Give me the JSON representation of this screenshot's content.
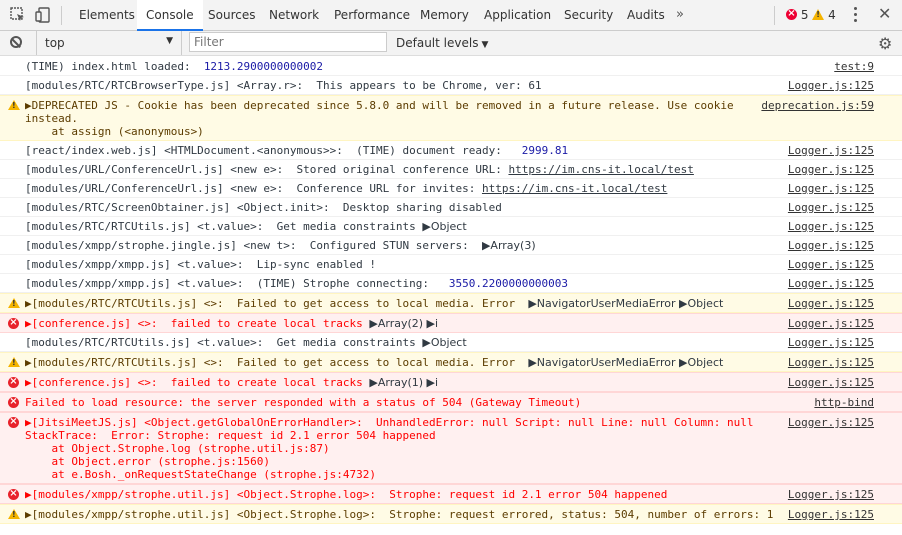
{
  "tabs": [
    {
      "label": "Elements"
    },
    {
      "label": "Console"
    },
    {
      "label": "Sources"
    },
    {
      "label": "Network"
    },
    {
      "label": "Performance"
    },
    {
      "label": "Memory"
    },
    {
      "label": "Application"
    },
    {
      "label": "Security"
    },
    {
      "label": "Audits"
    }
  ],
  "more_tabs": "»",
  "counts": {
    "errors": "5",
    "warnings": "4"
  },
  "toolbar": {
    "context": "top",
    "filter_placeholder": "Filter",
    "levels": "Default levels"
  },
  "colors": {
    "accent": "#1a73e8",
    "error_bg": "#fff0f0",
    "warn_bg": "#fffbe5",
    "error_text": "#ff0000"
  },
  "log": [
    {
      "level": "info",
      "text": "(TIME) index.html loaded:  ",
      "num": "1213.2900000000002",
      "source": "test:9"
    },
    {
      "level": "info",
      "text": "[modules/RTC/RTCBrowserType.js] <Array.r>:  This appears to be Chrome, ver: 61",
      "source": "Logger.js:125"
    },
    {
      "level": "warn",
      "text": "▶DEPRECATED JS - Cookie has been deprecated since 5.8.0 and will be removed in a future release. Use cookie\ninstead.\n    at assign (<anonymous>)",
      "source": "deprecation.js:59"
    },
    {
      "level": "info",
      "text": "[react/index.web.js] <HTMLDocument.<anonymous>>:  (TIME) document ready:   ",
      "num": "2999.81",
      "source": "Logger.js:125"
    },
    {
      "level": "info",
      "text": "[modules/URL/ConferenceUrl.js] <new e>:  Stored original conference URL: ",
      "link": "https://im.cns-it.local/test",
      "source": "Logger.js:125"
    },
    {
      "level": "info",
      "text": "[modules/URL/ConferenceUrl.js] <new e>:  Conference URL for invites: ",
      "link": "https://im.cns-it.local/test",
      "source": "Logger.js:125"
    },
    {
      "level": "info",
      "text": "[modules/RTC/ScreenObtainer.js] <Object.init>:  Desktop sharing disabled",
      "source": "Logger.js:125"
    },
    {
      "level": "info",
      "text": "[modules/RTC/RTCUtils.js] <t.value>:  Get media constraints ",
      "obj": "▶Object",
      "source": "Logger.js:125"
    },
    {
      "level": "info",
      "text": "[modules/xmpp/strophe.jingle.js] <new t>:  Configured STUN servers:  ",
      "obj": "▶Array(3)",
      "source": "Logger.js:125"
    },
    {
      "level": "info",
      "text": "[modules/xmpp/xmpp.js] <t.value>:  Lip-sync enabled !",
      "source": "Logger.js:125"
    },
    {
      "level": "info",
      "text": "[modules/xmpp/xmpp.js] <t.value>:  (TIME) Strophe connecting:   ",
      "num": "3550.2200000000003",
      "source": "Logger.js:125"
    },
    {
      "level": "warn",
      "text": "▶[modules/RTC/RTCUtils.js] <>:  Failed to get access to local media. Error  ",
      "obj": "▶NavigatorUserMediaError ▶Object",
      "source": "Logger.js:125"
    },
    {
      "level": "error",
      "text": "▶[conference.js] <>:  failed to create local tracks ",
      "obj": "▶Array(2) ▶i",
      "source": "Logger.js:125"
    },
    {
      "level": "info",
      "text": "[modules/RTC/RTCUtils.js] <t.value>:  Get media constraints ",
      "obj": "▶Object",
      "source": "Logger.js:125"
    },
    {
      "level": "warn",
      "text": "▶[modules/RTC/RTCUtils.js] <>:  Failed to get access to local media. Error  ",
      "obj": "▶NavigatorUserMediaError ▶Object",
      "source": "Logger.js:125"
    },
    {
      "level": "error",
      "text": "▶[conference.js] <>:  failed to create local tracks ",
      "obj": "▶Array(1) ▶i",
      "source": "Logger.js:125"
    },
    {
      "level": "error",
      "text": "Failed to load resource: the server responded with a status of 504 (Gateway Timeout)",
      "source": "http-bind"
    },
    {
      "level": "error",
      "text": "▶[JitsiMeetJS.js] <Object.getGlobalOnErrorHandler>:  UnhandledError: null Script: null Line: null Column: null\nStackTrace:  Error: Strophe: request id 2.1 error 504 happened\n    at Object.Strophe.log (strophe.util.js:87)\n    at Object.error (strophe.js:1560)\n    at e.Bosh._onRequestStateChange (strophe.js:4732)",
      "source": "Logger.js:125"
    },
    {
      "level": "error",
      "text": "▶[modules/xmpp/strophe.util.js] <Object.Strophe.log>:  Strophe: request id 2.1 error 504 happened",
      "source": "Logger.js:125"
    },
    {
      "level": "warn",
      "text": "▶[modules/xmpp/strophe.util.js] <Object.Strophe.log>:  Strophe: request errored, status: 504, number of errors: 1",
      "source": "Logger.js:125"
    }
  ]
}
